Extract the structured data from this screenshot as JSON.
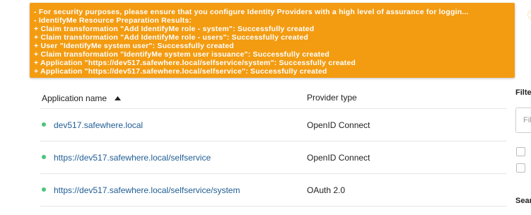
{
  "notification": {
    "lines": [
      "- For security purposes, please ensure that you configure Identity Providers with a high level of assurance for loggin...",
      "- IdentifyMe Resource Preparation Results:",
      "+ Claim transformation \"Add IdentifyMe role - system\": Successfully created",
      "+ Claim transformation \"Add IdentifyMe role - users\": Successfully created",
      "+ User \"IdentifyMe system user\": Successfully created",
      "+ Claim transformation \"IdentifyMe system user issuance\": Successfully created",
      "+ Application \"https://dev517.safewhere.local/selfservice/system\": Successfully created",
      "+ Application \"https://dev517.safewhere.local/selfservice\": Successfully created"
    ],
    "close_icon": "close-circle-icon",
    "color": "#f39c12"
  },
  "table": {
    "headers": {
      "name": "Application name",
      "type": "Provider type"
    },
    "sort_icon": "sort-ascending-icon",
    "rows": [
      {
        "name": "dev517.safewhere.local",
        "type": "OpenID Connect",
        "status_color": "#4cc47a"
      },
      {
        "name": "https://dev517.safewhere.local/selfservice",
        "type": "OpenID Connect",
        "status_color": "#4cc47a"
      },
      {
        "name": "https://dev517.safewhere.local/selfservice/system",
        "type": "OAuth 2.0",
        "status_color": "#4cc47a"
      }
    ]
  },
  "side_panel": {
    "title": "Filte",
    "input_placeholder": "Fil",
    "search_label": "Sear"
  }
}
